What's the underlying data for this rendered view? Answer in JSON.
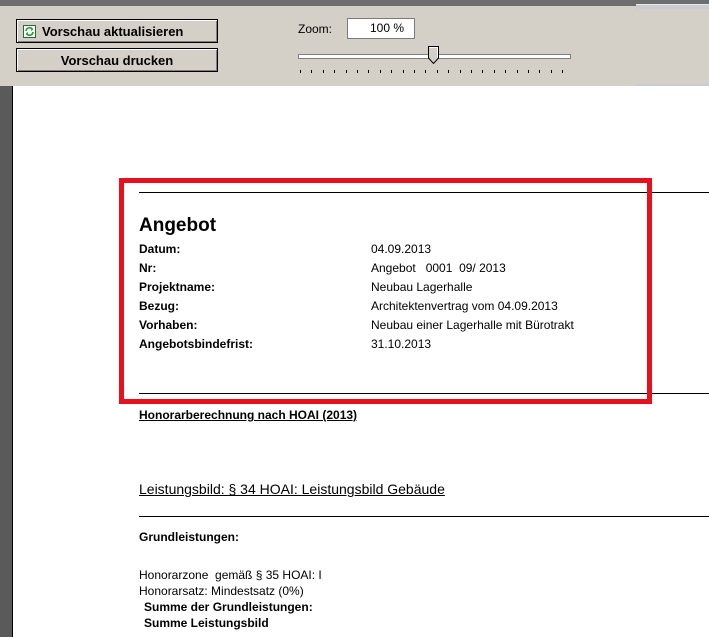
{
  "toolbar": {
    "refresh_label": "Vorschau aktualisieren",
    "print_label": "Vorschau drucken",
    "zoom_label": "Zoom:",
    "zoom_value": "100 %",
    "zoom_level_percent": 100
  },
  "document": {
    "title": "Angebot",
    "fields": [
      {
        "label": "Datum:",
        "value": "04.09.2013"
      },
      {
        "label": "Nr:",
        "value": "Angebot   0001  09/ 2013"
      },
      {
        "label": "Projektname:",
        "value": "Neubau Lagerhalle"
      },
      {
        "label": "Bezug:",
        "value": "Architektenvertrag vom 04.09.2013"
      },
      {
        "label": "Vorhaben:",
        "value": "Neubau einer Lagerhalle mit Bürotrakt"
      },
      {
        "label": "Angebotsbindefrist:",
        "value": "31.10.2013"
      }
    ],
    "section_title": "Honorarberechnung nach HOAI (2013)",
    "leistungsbild_title": "Leistungsbild: § 34 HOAI: Leistungsbild Gebäude",
    "grundleistungen": "Grundleistungen:",
    "honorarzone": "Honorarzone  gemäß § 35 HOAI: I",
    "honorarsatz": "Honorarsatz: Mindestsatz (0%)",
    "summe_grundleistungen": "Summe der Grundleistungen:",
    "summe_leistungsbild": "Summe Leistungsbild"
  },
  "colors": {
    "highlight_border": "#e8101c",
    "toolbar_bg": "#d4d0c8"
  }
}
